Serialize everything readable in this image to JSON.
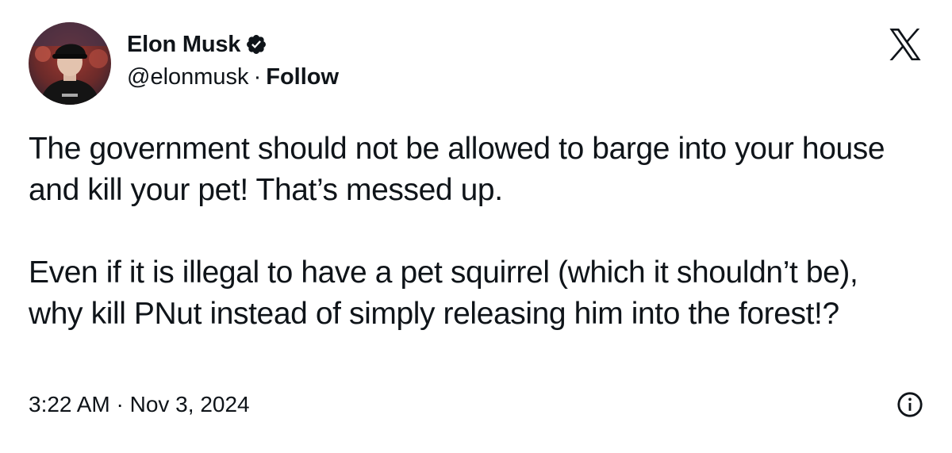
{
  "author": {
    "display_name": "Elon Musk",
    "handle": "@elonmusk",
    "separator": "·",
    "follow_label": "Follow",
    "verified_icon": "verified-badge-icon",
    "avatar_icon": "profile-photo"
  },
  "brand": {
    "logo_icon": "x-logo-icon"
  },
  "tweet": {
    "paragraphs": [
      "The government should not be allowed to barge into your house and kill your pet! That’s messed up.",
      "Even if it is illegal to have a pet squirrel (which it shouldn’t be), why kill PNut instead of simply releasing him into the forest!?"
    ]
  },
  "footer": {
    "timestamp": "3:22 AM · Nov 3, 2024",
    "info_icon": "info-icon"
  },
  "colors": {
    "text": "#0f1419",
    "background": "#ffffff"
  }
}
